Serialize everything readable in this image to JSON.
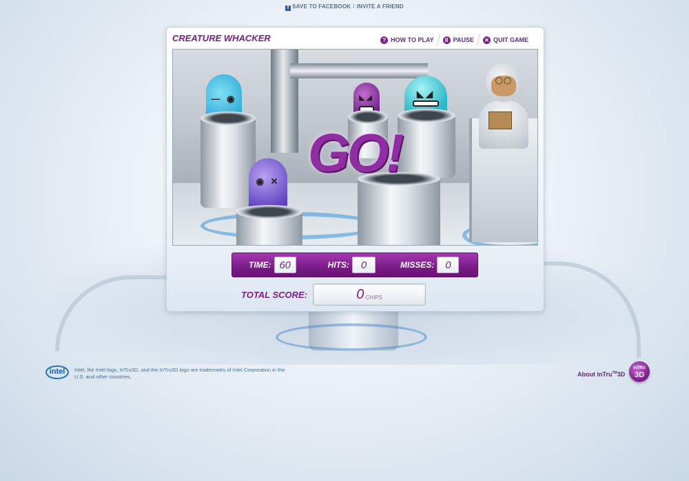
{
  "share": {
    "facebook_icon": "f",
    "facebook_label": "SAVE TO FACEBOOK",
    "separator": "/",
    "invite_label": "INVITE A FRIEND"
  },
  "game": {
    "title": "CREATURE WHACKER",
    "nav": {
      "how_to_play_icon": "?",
      "how_to_play": "HOW TO PLAY",
      "pause_icon": "II",
      "pause": "PAUSE",
      "quit_icon": "✕",
      "quit": "QUIT GAME"
    },
    "go_text": "GO!",
    "stats": {
      "time_label": "TIME:",
      "time_value": "60",
      "hits_label": "HITS:",
      "hits_value": "0",
      "misses_label": "MISSES:",
      "misses_value": "0"
    },
    "score": {
      "label": "TOTAL SCORE:",
      "value": "0",
      "unit": "CHIPS"
    }
  },
  "footer": {
    "intel_logo_text": "intel",
    "legal_text": "Intel, the Intel logo, InTru3D, and the InTru3D logo are trademarks of Intel Corporation in the U.S. and other countries.",
    "about_label": "About inTru",
    "about_tm": "TM",
    "about_suffix": "3D",
    "badge_line1": "inTRU",
    "badge_line2": "3D"
  },
  "colors": {
    "brand_purple": "#7b1d83",
    "stats_bar": "#8a2696",
    "intel_blue": "#0860a8"
  }
}
